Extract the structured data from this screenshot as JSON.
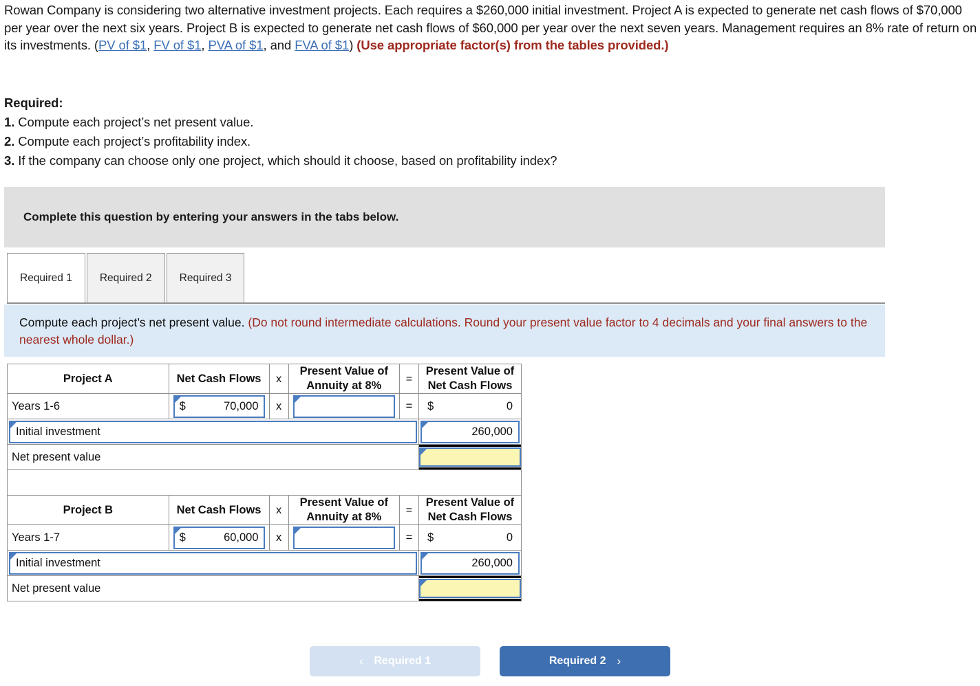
{
  "problem": {
    "para_1": "Rowan Company is considering two alternative investment projects. Each requires a $260,000 initial investment. Project A is expected to generate net cash flows of $70,000 per year over the next six years. Project B is expected to generate net cash flows of $60,000 per year over the next seven years. Management requires an 8% rate of return on its investments. (",
    "link_pv": "PV of $1",
    "link_fv": "FV of $1",
    "link_pva": "PVA of $1",
    "link_fva": "FVA of $1",
    "sep_1": ", ",
    "sep_2": ", ",
    "sep_3": ", and ",
    "close_paren": ") ",
    "use_factors": "(Use appropriate factor(s) from the tables provided.)"
  },
  "required": {
    "heading": "Required:",
    "items": [
      {
        "num": "1.",
        "text": "Compute each project’s net present value."
      },
      {
        "num": "2.",
        "text": "Compute each project’s profitability index."
      },
      {
        "num": "3.",
        "text": "If the company can choose only one project, which should it choose, based on profitability index?"
      }
    ]
  },
  "banner": {
    "text": "Complete this question by entering your answers in the tabs below."
  },
  "tabs": [
    {
      "label": "Required 1",
      "active": true
    },
    {
      "label": "Required 2",
      "active": false
    },
    {
      "label": "Required 3",
      "active": false
    }
  ],
  "instruction": {
    "black": "Compute each project’s net present value. ",
    "red": "(Do not round intermediate calculations. Round your present value factor to 4 decimals and your final answers to the nearest whole dollar.)"
  },
  "worksheet": {
    "headers": {
      "net_cash_flows": "Net Cash Flows",
      "times": "x",
      "pv_annuity": "Present Value of Annuity at 8%",
      "equals": "=",
      "pv_net_cash_flows": "Present Value of Net Cash Flows"
    },
    "tables": [
      {
        "title": "Project A",
        "rows": {
          "years_label": "Years 1-6",
          "cash_flow_dollar": "$",
          "cash_flow_value": "70,000",
          "times": "x",
          "factor_value": "",
          "equals": "=",
          "pv_dollar": "$",
          "pv_value": "0",
          "initial_investment_label": "Initial investment",
          "initial_investment_value": "260,000",
          "npv_label": "Net present value",
          "npv_value": ""
        }
      },
      {
        "title": "Project B",
        "rows": {
          "years_label": "Years 1-7",
          "cash_flow_dollar": "$",
          "cash_flow_value": "60,000",
          "times": "x",
          "factor_value": "",
          "equals": "=",
          "pv_dollar": "$",
          "pv_value": "0",
          "initial_investment_label": "Initial investment",
          "initial_investment_value": "260,000",
          "npv_label": "Net present value",
          "npv_value": ""
        }
      }
    ]
  },
  "nav": {
    "prev_label": "Required 1",
    "prev_chevron": "‹",
    "next_label": "Required 2",
    "next_chevron": "›"
  },
  "colors": {
    "header_blue": "#8cb3de",
    "input_border": "#4a7cc0",
    "answer_yellow": "#fbf6b4",
    "banner_gray": "#e0e0e0",
    "instruction_blue": "#dce9f7",
    "link_blue": "#3b6fb6",
    "emphasis_red": "#9e2a1f",
    "next_button_blue": "#3e6fb0",
    "prev_button_blue": "#d4e1f2"
  }
}
